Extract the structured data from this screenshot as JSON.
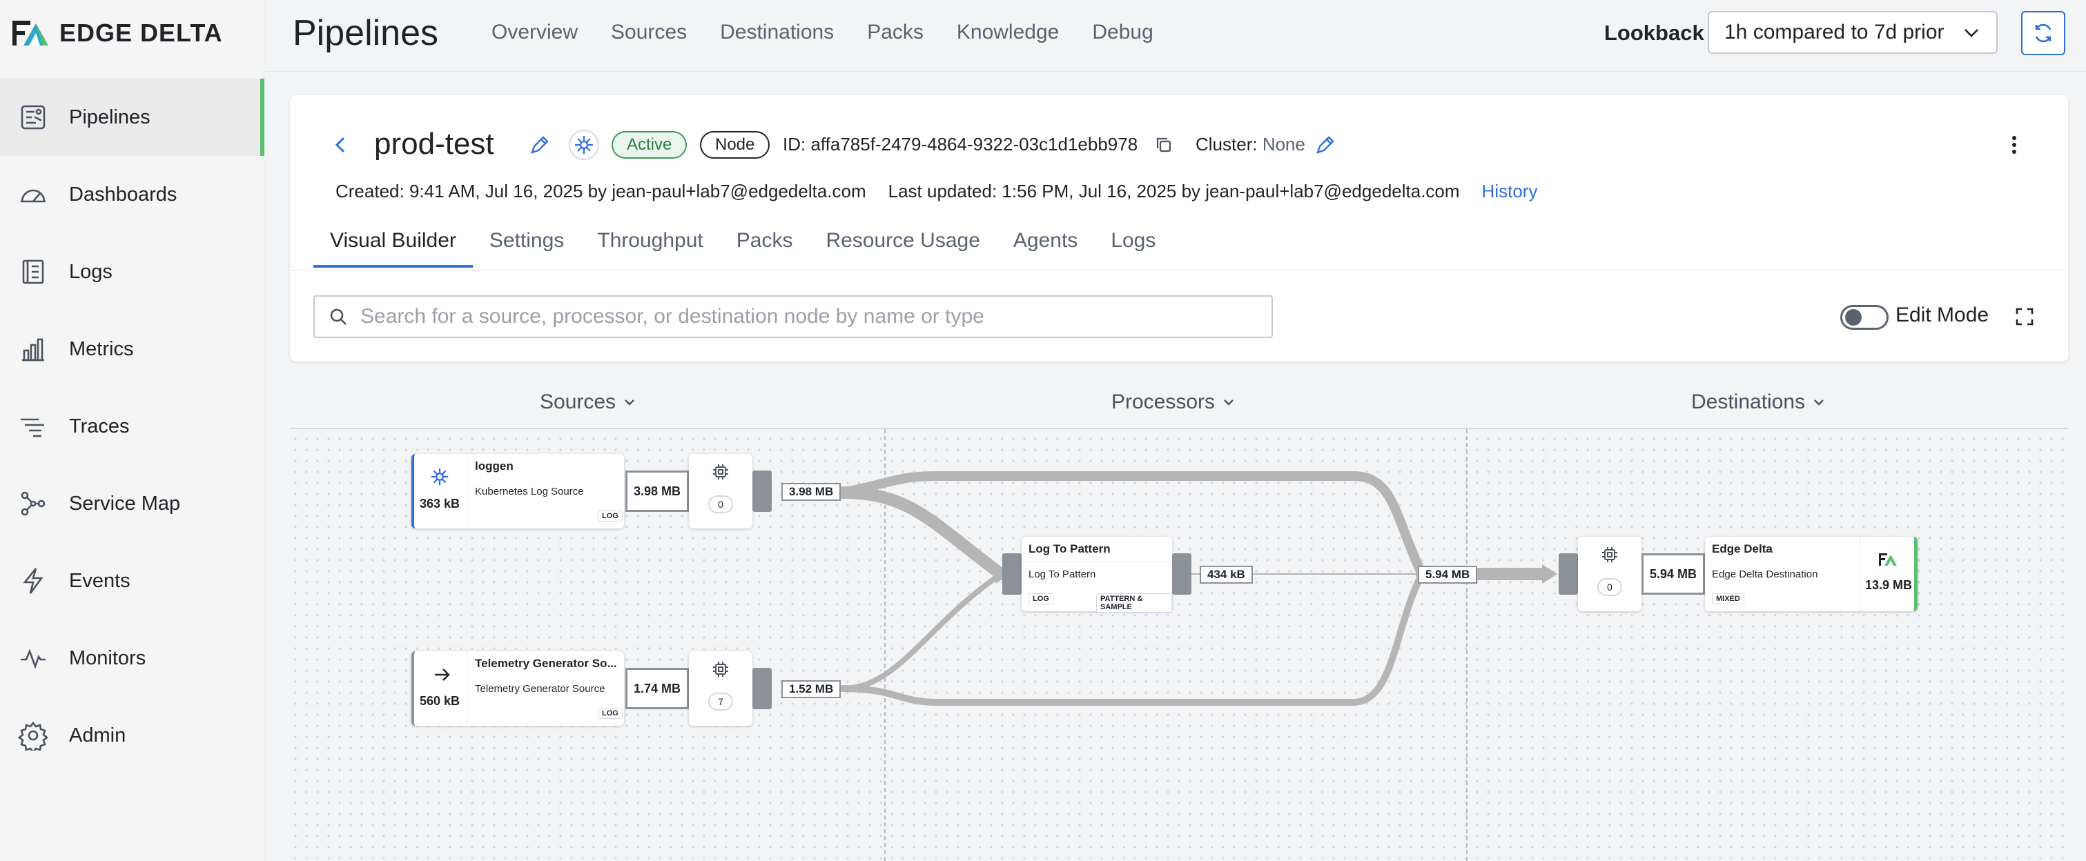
{
  "app": {
    "brand": "EDGE DELTA"
  },
  "sidebar": {
    "items": [
      {
        "label": "Pipelines",
        "icon": "pipelines-icon",
        "active": true
      },
      {
        "label": "Dashboards",
        "icon": "gauge-icon"
      },
      {
        "label": "Logs",
        "icon": "logs-icon"
      },
      {
        "label": "Metrics",
        "icon": "bar-chart-icon"
      },
      {
        "label": "Traces",
        "icon": "traces-icon"
      },
      {
        "label": "Service Map",
        "icon": "network-icon"
      },
      {
        "label": "Events",
        "icon": "lightning-icon"
      },
      {
        "label": "Monitors",
        "icon": "pulse-icon"
      },
      {
        "label": "Admin",
        "icon": "gear-icon"
      }
    ]
  },
  "header": {
    "title": "Pipelines",
    "links": [
      "Overview",
      "Sources",
      "Destinations",
      "Packs",
      "Knowledge",
      "Debug"
    ],
    "lookback_label": "Lookback",
    "lookback_value": "1h compared to 7d prior"
  },
  "pipeline": {
    "name": "prod-test",
    "status": "Active",
    "type": "Node",
    "id_text": "ID: affa785f-2479-4864-9322-03c1d1ebb978",
    "cluster_label": "Cluster:",
    "cluster_value": "None",
    "created": "Created: 9:41 AM, Jul 16, 2025 by jean-paul+lab7@edgedelta.com",
    "updated": "Last updated: 1:56 PM, Jul 16, 2025 by jean-paul+lab7@edgedelta.com",
    "history_link": "History",
    "tabs": [
      "Visual Builder",
      "Settings",
      "Throughput",
      "Packs",
      "Resource Usage",
      "Agents",
      "Logs"
    ],
    "active_tab": "Visual Builder",
    "search_placeholder": "Search for a source, processor, or destination node by name or type",
    "edit_mode_label": "Edit Mode",
    "edit_mode_on": false
  },
  "builder": {
    "columns": [
      "Sources",
      "Processors",
      "Destinations"
    ],
    "sources": [
      {
        "title": "loggen",
        "subtitle": "Kubernetes Log Source",
        "tag": "LOG",
        "size": "363 kB",
        "icon": "kubernetes-icon",
        "output": "3.98 MB",
        "proc_count": "0",
        "edge": "3.98 MB"
      },
      {
        "title": "Telemetry Generator So...",
        "subtitle": "Telemetry Generator Source",
        "tag": "LOG",
        "size": "560 kB",
        "icon": "arrow-right-icon",
        "output": "1.74 MB",
        "proc_count": "7",
        "edge": "1.52 MB"
      }
    ],
    "processor": {
      "title": "Log To Pattern",
      "subtitle": "Log To Pattern",
      "tags": [
        "LOG",
        "PATTERN & SAMPLE"
      ],
      "edge": "434 kB"
    },
    "merge_edge": "5.94 MB",
    "destination": {
      "title": "Edge Delta",
      "subtitle": "Edge Delta Destination",
      "tag": "MIXED",
      "size": "13.9 MB",
      "input": "5.94 MB",
      "proc_count": "0",
      "icon": "edge-delta-logo-icon"
    },
    "colors": {
      "accent": "#2e6fd6",
      "active_green": "#58c06e",
      "flow": "#b5b5b5",
      "port": "#8c9097",
      "k8s_blue": "#326ce5"
    }
  }
}
